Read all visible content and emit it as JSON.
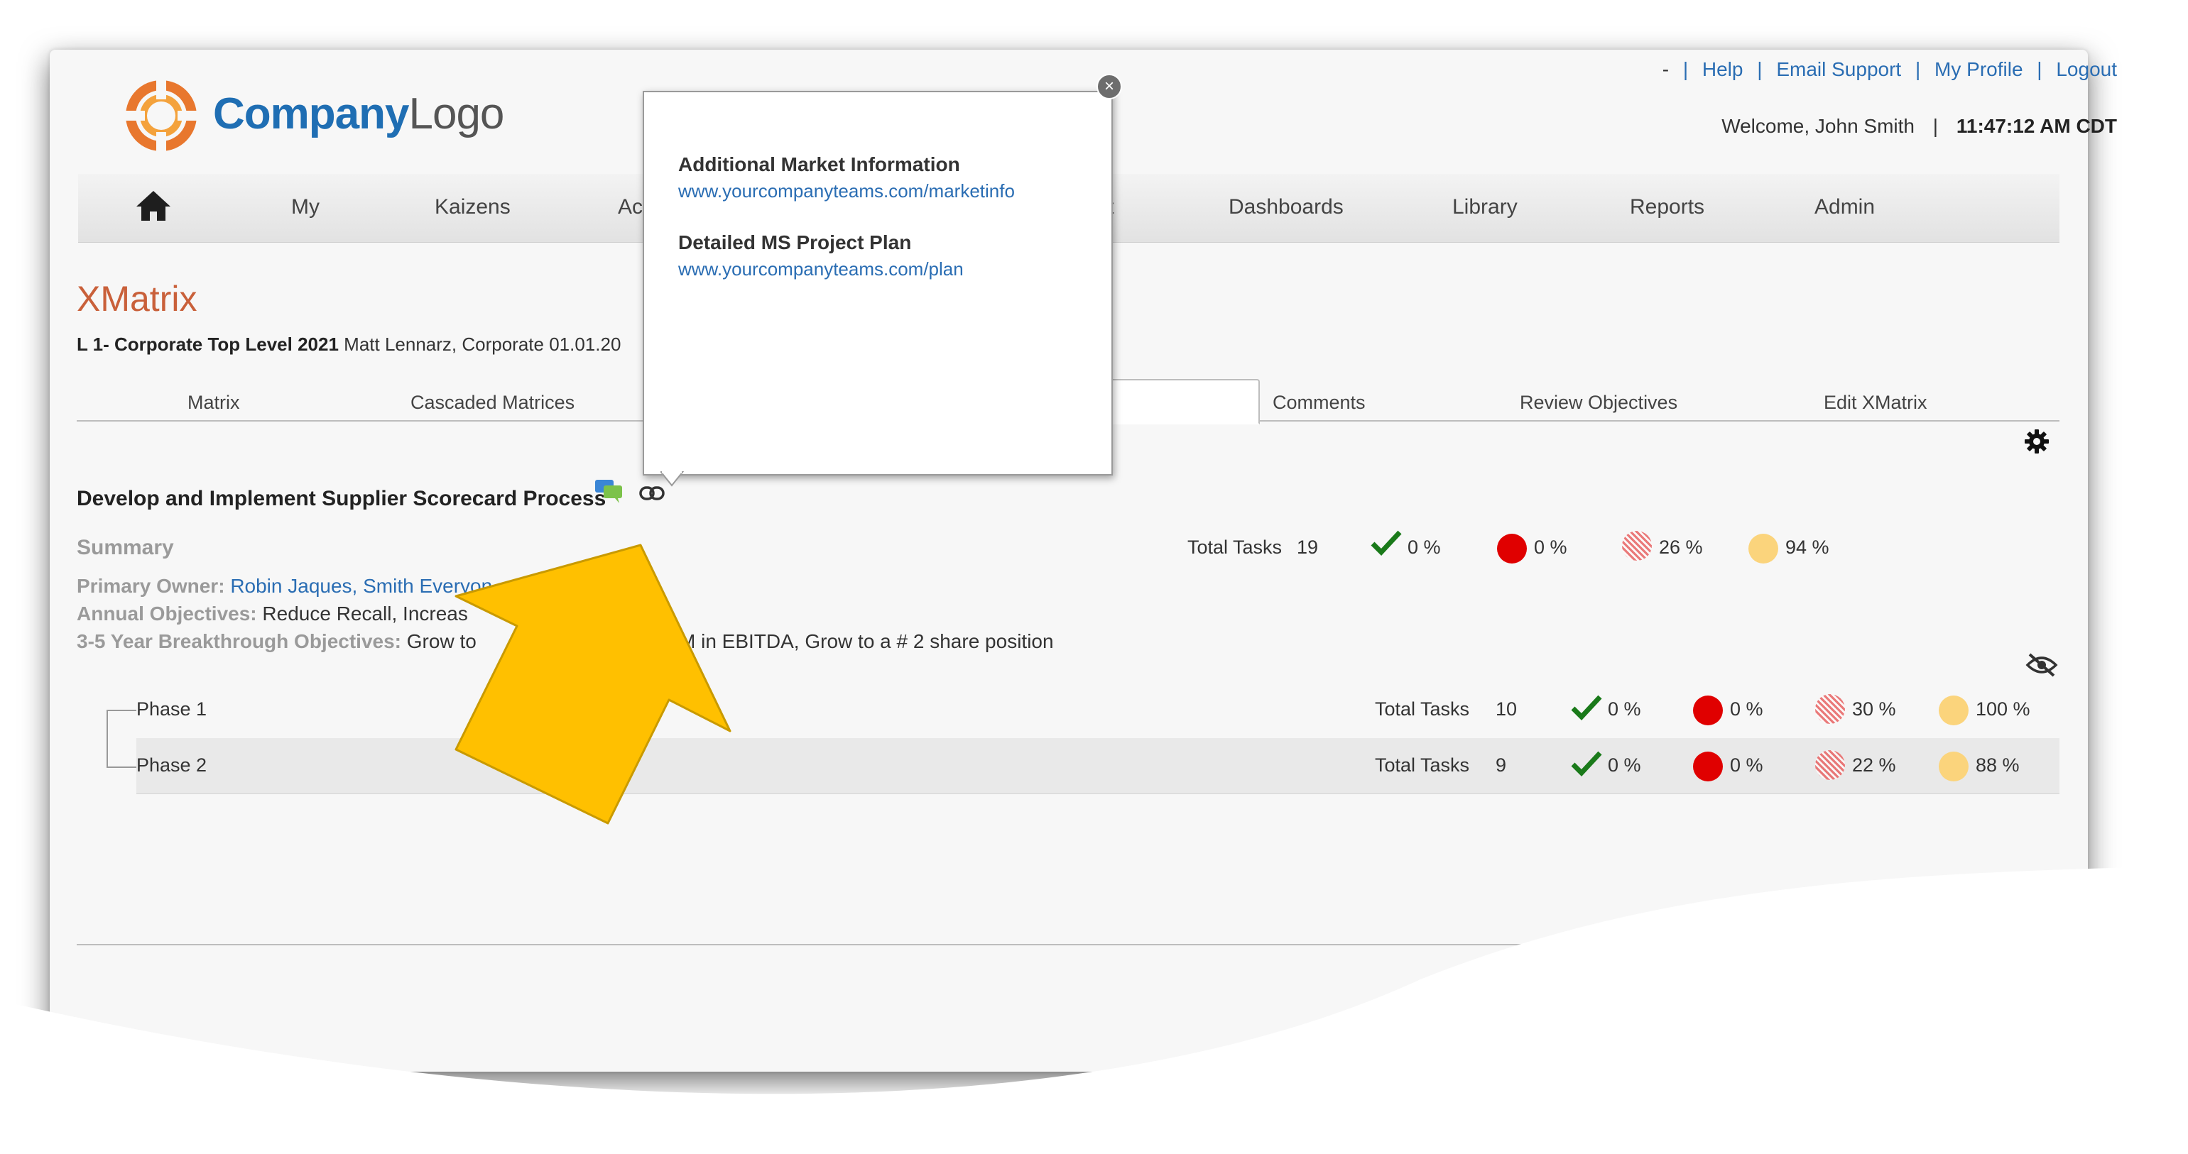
{
  "header": {
    "top_links": [
      "-",
      "Help",
      "Email Support",
      "My Profile",
      "Logout"
    ],
    "welcome": "Welcome, John Smith",
    "time": "11:47:12 AM CDT",
    "logo_bold": "Company",
    "logo_light": "Logo"
  },
  "nav": {
    "home_icon": "home-icon",
    "items": [
      "My",
      "Kaizens",
      "Ac",
      "t",
      "Dashboards",
      "Library",
      "Reports",
      "Admin"
    ]
  },
  "page": {
    "title": "XMatrix",
    "subtitle_bold": "L 1- Corporate Top Level 2021",
    "subtitle_rest": "Matt Lennarz, Corporate 01.01.20"
  },
  "tabs": [
    "Matrix",
    "Cascaded Matrices",
    "Comments",
    "Review Objectives",
    "Edit XMatrix"
  ],
  "objective": {
    "title": "Develop and Implement Supplier Scorecard Process",
    "summary_label": "Summary",
    "primary_owner_label": "Primary Owner:",
    "primary_owner_value": "Robin Jaques, Smith Everyon",
    "annual_label": "Annual Objectives:",
    "annual_value": "Reduce Recall, Increas",
    "breakthrough_label": "3-5 Year Breakthrough Objectives:",
    "breakthrough_value_a": "Grow to",
    "breakthrough_value_b": "M in EBITDA, Grow to a # 2 share position",
    "total_label": "Total Tasks",
    "total": "19",
    "complete": "0 %",
    "red": "0 %",
    "hatched": "26 %",
    "yellow": "94 %"
  },
  "phases": [
    {
      "name": "Phase 1",
      "total_label": "Total Tasks",
      "total": "10",
      "complete": "0 %",
      "red": "0 %",
      "hatched": "30 %",
      "yellow": "100 %"
    },
    {
      "name": "Phase 2",
      "total_label": "Total Tasks",
      "total": "9",
      "complete": "0 %",
      "red": "0 %",
      "hatched": "22 %",
      "yellow": "88 %"
    }
  ],
  "popup": {
    "item1_title": "Additional Market Information",
    "item1_link": "www.yourcompanyteams.com/marketinfo",
    "item2_title": "Detailed MS Project Plan",
    "item2_link": "www.yourcompanyteams.com/plan"
  },
  "colors": {
    "accent_title": "#c9603a",
    "link": "#2a6db3",
    "arrow": "#ffc000",
    "status_red": "#e00000",
    "status_yellow": "#fbd47c",
    "status_green": "#1a7a1a"
  }
}
